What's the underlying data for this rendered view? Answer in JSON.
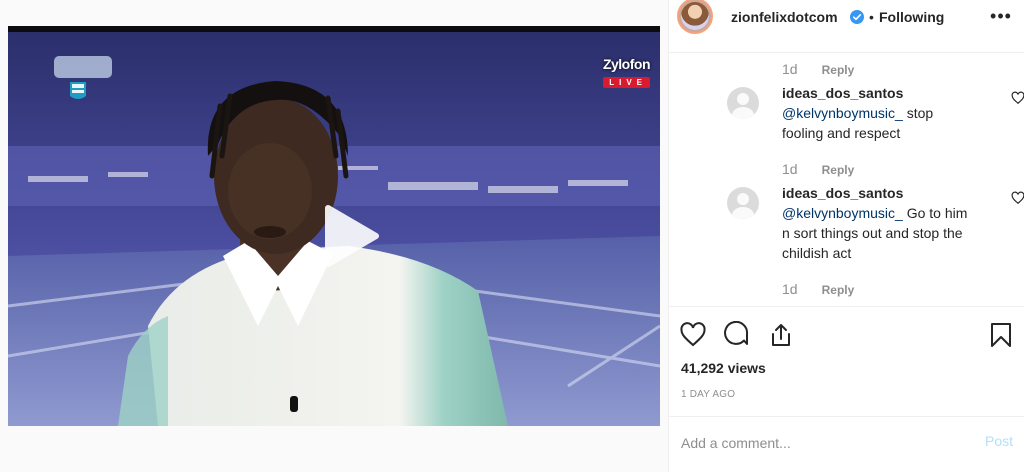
{
  "video": {
    "play_icon": "play-icon",
    "overlay": {
      "brand": "Zylofon",
      "live": "LIVE"
    }
  },
  "post_header": {
    "username": "zionfelixdotcom",
    "verified_icon": "verified-badge-icon",
    "separator": "•",
    "follow_state": "Following",
    "more_icon": "more-options-icon",
    "more_label": "•••"
  },
  "comments": {
    "items": [
      {
        "time": "1d",
        "reply_label": "Reply"
      },
      {
        "username": "ideas_dos_santos",
        "mention": "@kelvynboymusic_",
        "text": " stop fooling and respect",
        "time": "1d",
        "reply_label": "Reply"
      },
      {
        "username": "ideas_dos_santos",
        "mention": "@kelvynboymusic_",
        "text": " Go to him n sort things out and stop the childish act",
        "time": "1d",
        "reply_label": "Reply"
      }
    ]
  },
  "actions": {
    "icons": [
      "heart-icon",
      "comment-icon",
      "share-icon",
      "bookmark-icon"
    ],
    "views": "41,292 views",
    "posted": "1 DAY AGO"
  },
  "composer": {
    "placeholder": "Add a comment...",
    "post_label": "Post"
  },
  "colors": {
    "text": "#262626",
    "muted": "#8e8e8e",
    "mention": "#003569",
    "post_disabled": "#b2dffc",
    "verified": "#3897f0",
    "live_red": "#d81b2e"
  }
}
